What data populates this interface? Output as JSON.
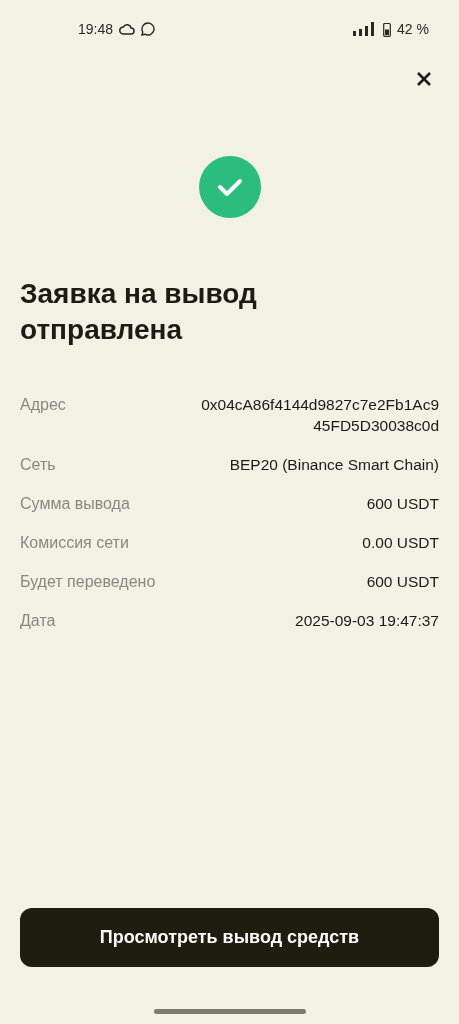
{
  "status_bar": {
    "time": "19:48",
    "battery": "42 %"
  },
  "title": "Заявка на вывод отправлена",
  "details": [
    {
      "label": "Адрес",
      "value": "0x04cA86f4144d9827c7e2Fb1Ac945FD5D30038c0d"
    },
    {
      "label": "Сеть",
      "value": "BEP20 (Binance Smart Chain)"
    },
    {
      "label": "Сумма вывода",
      "value": "600 USDT"
    },
    {
      "label": "Комиссия сети",
      "value": "0.00 USDT"
    },
    {
      "label": "Будет переведено",
      "value": "600 USDT"
    },
    {
      "label": "Дата",
      "value": "2025-09-03 19:47:37"
    }
  ],
  "button": "Просмотреть вывод средств"
}
